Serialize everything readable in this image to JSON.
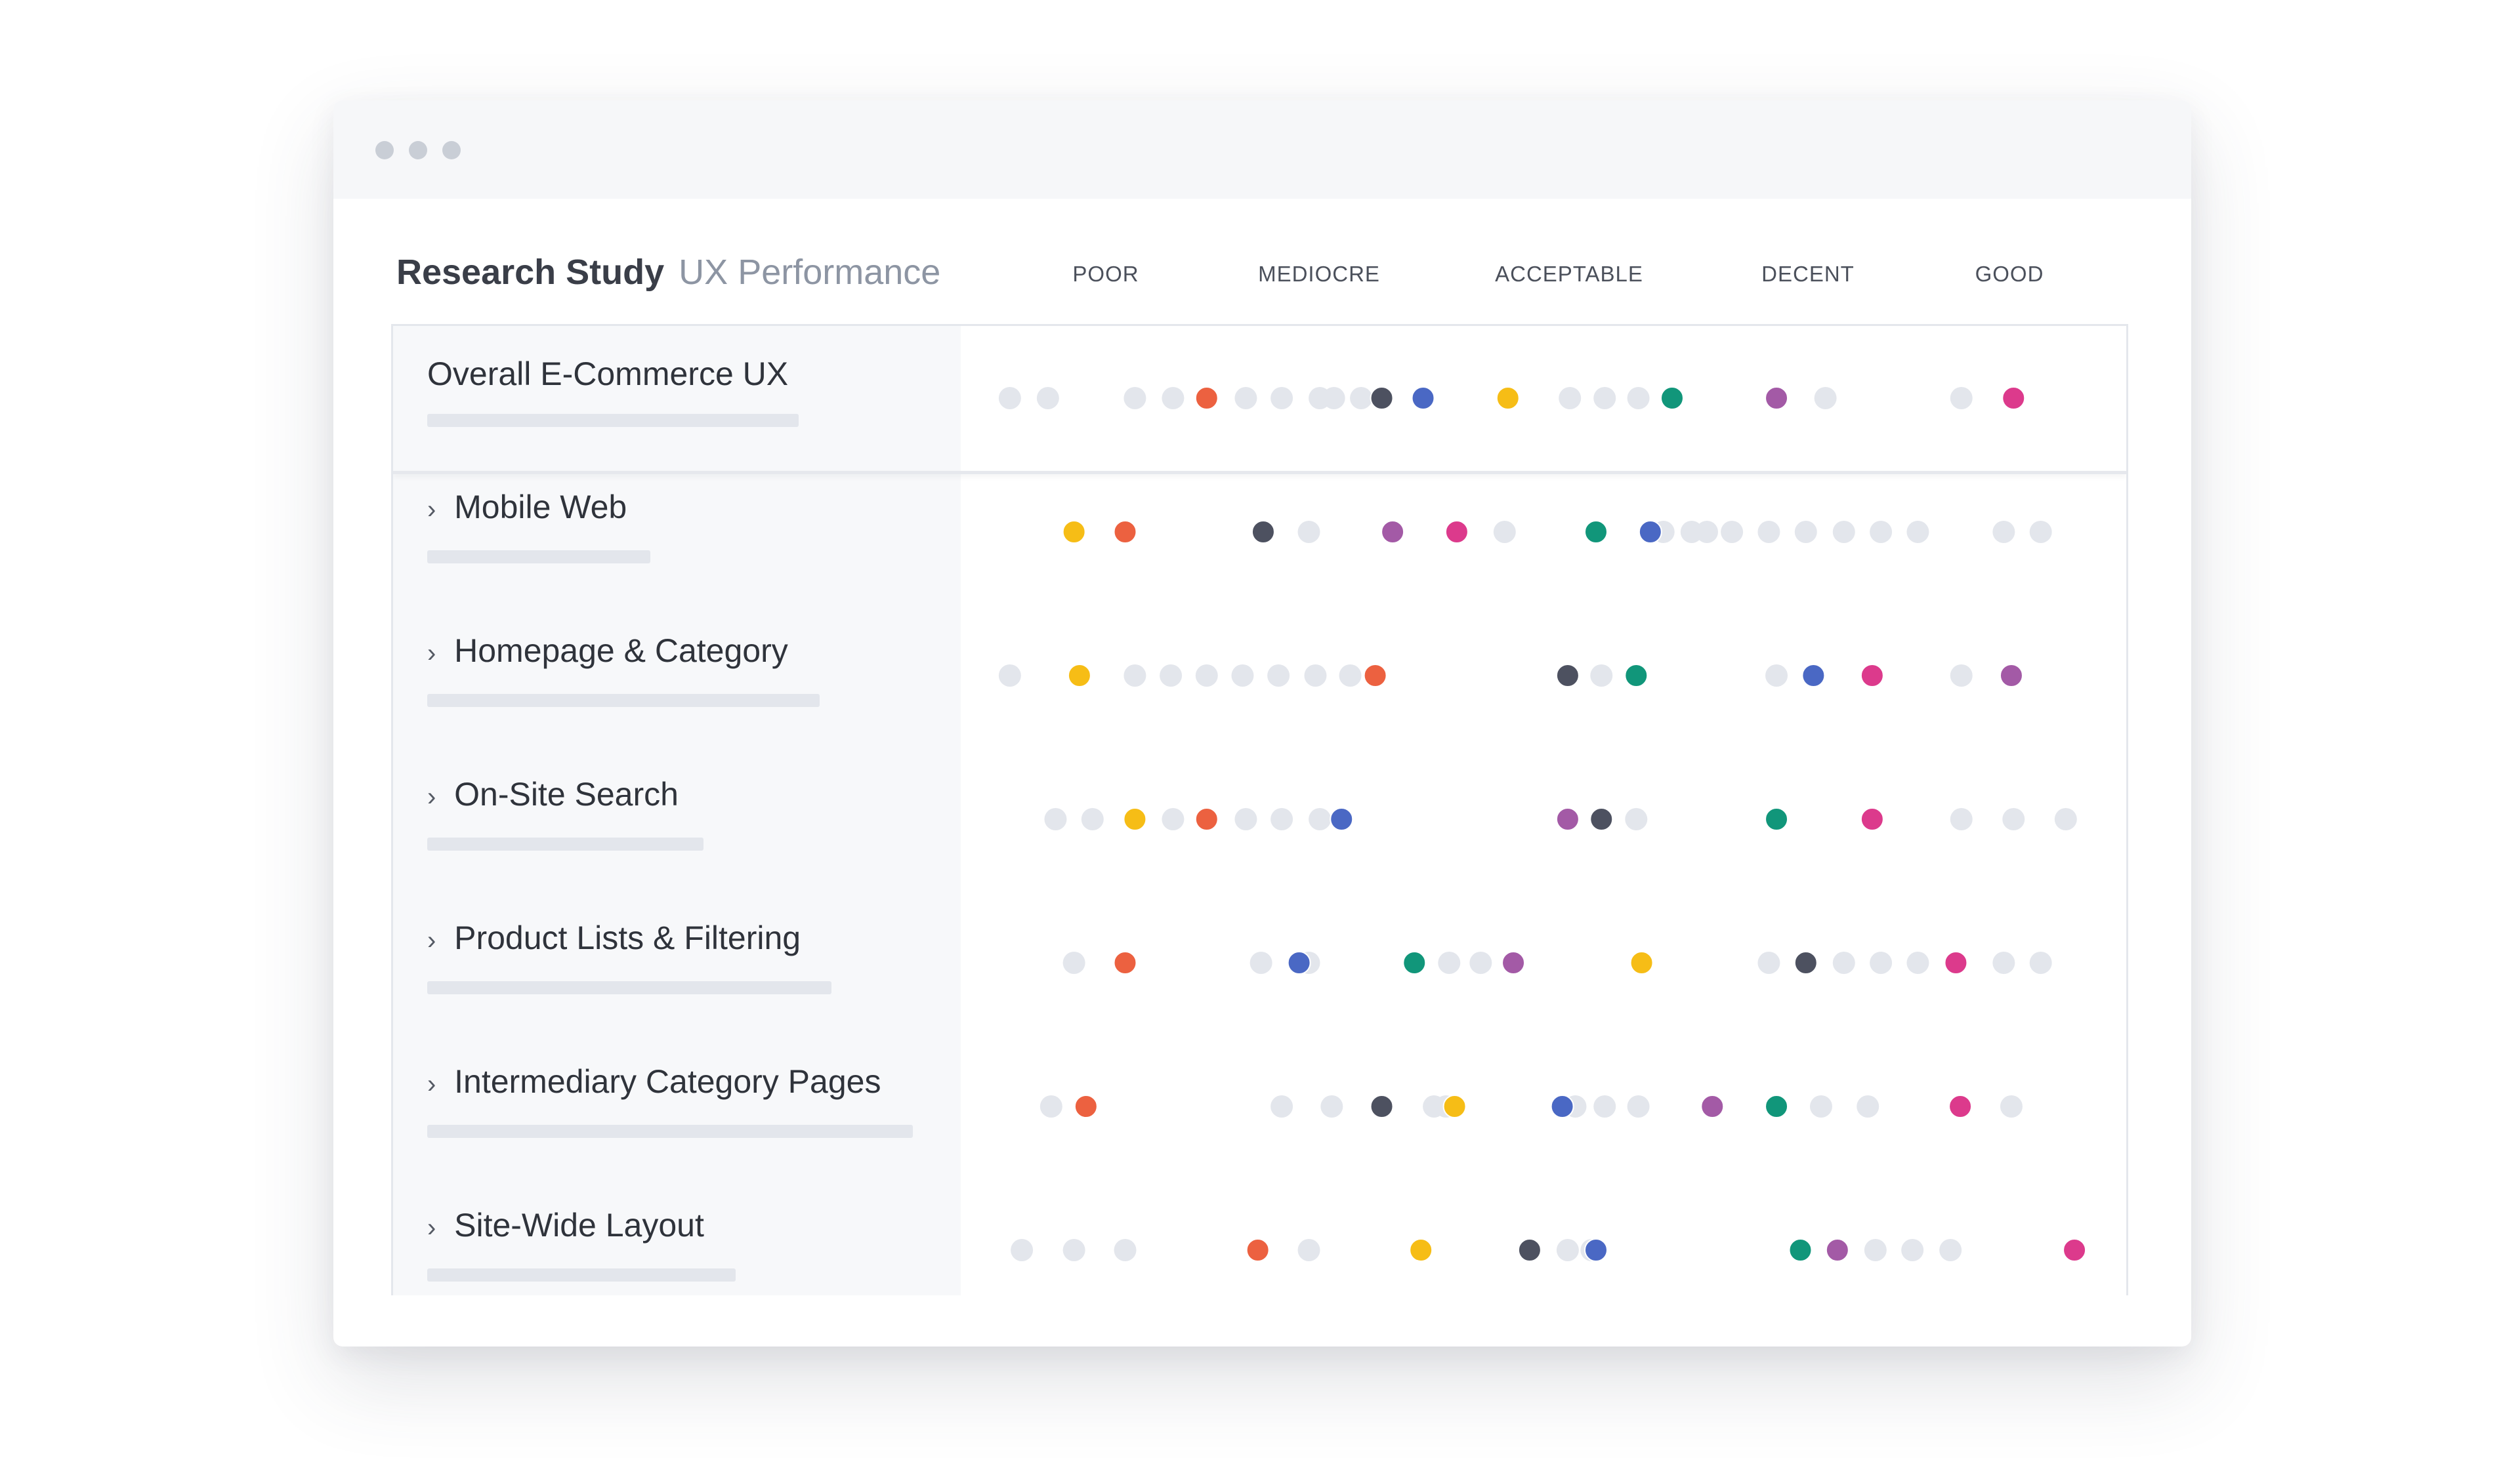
{
  "header": {
    "title": "Research Study",
    "subtitle": "UX Performance"
  },
  "colors": {
    "neutral": "#e3e6ec",
    "red": "#ec6140",
    "dark": "#4d5160",
    "blue": "#4a68c4",
    "yellow": "#f6bd16",
    "green": "#11967a",
    "purple": "#a35aa6",
    "pink": "#dc3a8c"
  },
  "chart_data": {
    "type": "scatter",
    "scale_labels": [
      "POOR",
      "MEDIOCRE",
      "ACCEPTABLE",
      "DECENT",
      "GOOD"
    ],
    "xlim": [
      0,
      100
    ],
    "rows": [
      {
        "label": "Overall E-Commerce UX",
        "points": [
          {
            "x": 1.5,
            "color": "neutral"
          },
          {
            "x": 5.0,
            "color": "neutral"
          },
          {
            "x": 13.0,
            "color": "neutral"
          },
          {
            "x": 16.5,
            "color": "neutral"
          },
          {
            "x": 19.6,
            "color": "red"
          },
          {
            "x": 23.2,
            "color": "neutral"
          },
          {
            "x": 26.5,
            "color": "neutral"
          },
          {
            "x": 30.0,
            "color": "neutral"
          },
          {
            "x": 31.3,
            "color": "neutral"
          },
          {
            "x": 33.8,
            "color": "neutral"
          },
          {
            "x": 35.7,
            "color": "dark"
          },
          {
            "x": 39.5,
            "color": "blue"
          },
          {
            "x": 47.3,
            "color": "yellow"
          },
          {
            "x": 53.0,
            "color": "neutral"
          },
          {
            "x": 56.2,
            "color": "neutral"
          },
          {
            "x": 59.3,
            "color": "neutral"
          },
          {
            "x": 62.4,
            "color": "green"
          },
          {
            "x": 72.0,
            "color": "purple"
          },
          {
            "x": 76.5,
            "color": "neutral"
          },
          {
            "x": 89.0,
            "color": "neutral"
          },
          {
            "x": 93.8,
            "color": "pink"
          }
        ]
      },
      {
        "label": "Mobile Web",
        "points": [
          {
            "x": 7.4,
            "color": "yellow"
          },
          {
            "x": 12.1,
            "color": "red"
          },
          {
            "x": 24.8,
            "color": "dark"
          },
          {
            "x": 29.0,
            "color": "neutral"
          },
          {
            "x": 36.7,
            "color": "purple"
          },
          {
            "x": 42.6,
            "color": "pink"
          },
          {
            "x": 47.0,
            "color": "neutral"
          },
          {
            "x": 55.4,
            "color": "green"
          },
          {
            "x": 61.6,
            "color": "neutral"
          },
          {
            "x": 64.2,
            "color": "neutral"
          },
          {
            "x": 65.6,
            "color": "neutral"
          },
          {
            "x": 67.9,
            "color": "neutral"
          },
          {
            "x": 71.3,
            "color": "neutral"
          },
          {
            "x": 74.7,
            "color": "neutral"
          },
          {
            "x": 78.2,
            "color": "neutral"
          },
          {
            "x": 81.6,
            "color": "neutral"
          },
          {
            "x": 85.0,
            "color": "neutral"
          },
          {
            "x": 92.9,
            "color": "neutral"
          },
          {
            "x": 96.3,
            "color": "neutral"
          },
          {
            "x": 60.4,
            "color": "blue"
          }
        ]
      },
      {
        "label": "Homepage & Category",
        "points": [
          {
            "x": 1.5,
            "color": "neutral"
          },
          {
            "x": 7.9,
            "color": "yellow"
          },
          {
            "x": 13.0,
            "color": "neutral"
          },
          {
            "x": 16.3,
            "color": "neutral"
          },
          {
            "x": 19.6,
            "color": "neutral"
          },
          {
            "x": 22.9,
            "color": "neutral"
          },
          {
            "x": 26.2,
            "color": "neutral"
          },
          {
            "x": 29.6,
            "color": "neutral"
          },
          {
            "x": 32.8,
            "color": "neutral"
          },
          {
            "x": 35.1,
            "color": "red"
          },
          {
            "x": 52.8,
            "color": "dark"
          },
          {
            "x": 55.9,
            "color": "neutral"
          },
          {
            "x": 59.1,
            "color": "green"
          },
          {
            "x": 72.0,
            "color": "neutral"
          },
          {
            "x": 75.4,
            "color": "blue"
          },
          {
            "x": 80.8,
            "color": "pink"
          },
          {
            "x": 89.0,
            "color": "neutral"
          },
          {
            "x": 93.6,
            "color": "purple"
          }
        ]
      },
      {
        "label": "On-Site Search",
        "points": [
          {
            "x": 5.7,
            "color": "neutral"
          },
          {
            "x": 9.1,
            "color": "neutral"
          },
          {
            "x": 13.0,
            "color": "yellow"
          },
          {
            "x": 16.5,
            "color": "neutral"
          },
          {
            "x": 19.6,
            "color": "red"
          },
          {
            "x": 23.2,
            "color": "neutral"
          },
          {
            "x": 26.5,
            "color": "neutral"
          },
          {
            "x": 30.0,
            "color": "neutral"
          },
          {
            "x": 32.0,
            "color": "blue"
          },
          {
            "x": 52.8,
            "color": "purple"
          },
          {
            "x": 55.9,
            "color": "dark"
          },
          {
            "x": 59.1,
            "color": "neutral"
          },
          {
            "x": 72.0,
            "color": "green"
          },
          {
            "x": 80.8,
            "color": "pink"
          },
          {
            "x": 89.0,
            "color": "neutral"
          },
          {
            "x": 93.8,
            "color": "neutral"
          },
          {
            "x": 98.6,
            "color": "neutral"
          }
        ]
      },
      {
        "label": "Product Lists & Filtering",
        "points": [
          {
            "x": 7.4,
            "color": "neutral"
          },
          {
            "x": 12.1,
            "color": "red"
          },
          {
            "x": 24.6,
            "color": "neutral"
          },
          {
            "x": 29.0,
            "color": "neutral"
          },
          {
            "x": 28.1,
            "color": "blue"
          },
          {
            "x": 38.7,
            "color": "green"
          },
          {
            "x": 41.9,
            "color": "neutral"
          },
          {
            "x": 44.8,
            "color": "neutral"
          },
          {
            "x": 47.8,
            "color": "purple"
          },
          {
            "x": 59.6,
            "color": "yellow"
          },
          {
            "x": 71.3,
            "color": "neutral"
          },
          {
            "x": 74.7,
            "color": "dark"
          },
          {
            "x": 78.2,
            "color": "neutral"
          },
          {
            "x": 81.6,
            "color": "neutral"
          },
          {
            "x": 85.0,
            "color": "neutral"
          },
          {
            "x": 88.5,
            "color": "pink"
          },
          {
            "x": 92.9,
            "color": "neutral"
          },
          {
            "x": 96.3,
            "color": "neutral"
          }
        ]
      },
      {
        "label": "Intermediary Category Pages",
        "points": [
          {
            "x": 5.3,
            "color": "neutral"
          },
          {
            "x": 8.5,
            "color": "red"
          },
          {
            "x": 26.5,
            "color": "neutral"
          },
          {
            "x": 31.1,
            "color": "neutral"
          },
          {
            "x": 35.7,
            "color": "dark"
          },
          {
            "x": 40.5,
            "color": "neutral"
          },
          {
            "x": 41.6,
            "color": "neutral"
          },
          {
            "x": 42.4,
            "color": "yellow"
          },
          {
            "x": 53.5,
            "color": "neutral"
          },
          {
            "x": 56.2,
            "color": "neutral"
          },
          {
            "x": 59.3,
            "color": "neutral"
          },
          {
            "x": 52.3,
            "color": "blue"
          },
          {
            "x": 66.1,
            "color": "purple"
          },
          {
            "x": 72.0,
            "color": "green"
          },
          {
            "x": 76.1,
            "color": "neutral"
          },
          {
            "x": 80.4,
            "color": "neutral"
          },
          {
            "x": 88.9,
            "color": "pink"
          },
          {
            "x": 93.6,
            "color": "neutral"
          }
        ]
      },
      {
        "label": "Site-Wide Layout",
        "points": [
          {
            "x": 2.6,
            "color": "neutral"
          },
          {
            "x": 7.4,
            "color": "neutral"
          },
          {
            "x": 12.1,
            "color": "neutral"
          },
          {
            "x": 24.3,
            "color": "red"
          },
          {
            "x": 29.0,
            "color": "neutral"
          },
          {
            "x": 39.3,
            "color": "yellow"
          },
          {
            "x": 49.3,
            "color": "dark"
          },
          {
            "x": 52.8,
            "color": "neutral"
          },
          {
            "x": 55.0,
            "color": "neutral"
          },
          {
            "x": 55.4,
            "color": "blue"
          },
          {
            "x": 74.2,
            "color": "green"
          },
          {
            "x": 77.6,
            "color": "purple"
          },
          {
            "x": 81.1,
            "color": "neutral"
          },
          {
            "x": 84.5,
            "color": "neutral"
          },
          {
            "x": 88.0,
            "color": "neutral"
          },
          {
            "x": 99.4,
            "color": "pink"
          }
        ]
      }
    ]
  }
}
